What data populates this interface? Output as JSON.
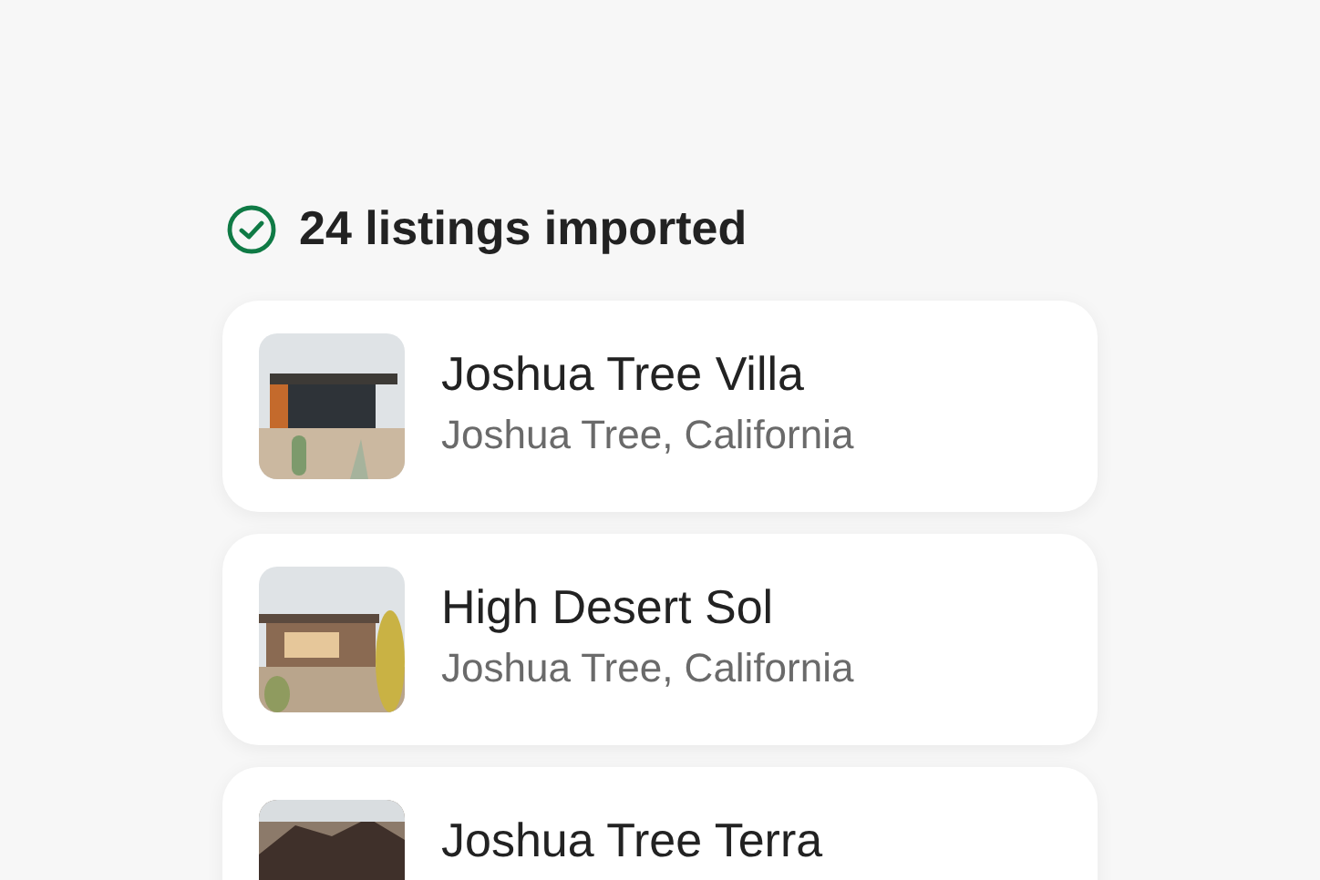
{
  "status": {
    "text": "24 listings imported",
    "done": true
  },
  "listings": [
    {
      "name": "Joshua Tree Villa",
      "location": "Joshua Tree, California",
      "kind": "picture"
    },
    {
      "name": "High Desert Sol",
      "location": "Joshua Tree, California",
      "kind": "picture"
    },
    {
      "name": "Joshua Tree Terra",
      "kind": "picture"
    }
  ]
}
